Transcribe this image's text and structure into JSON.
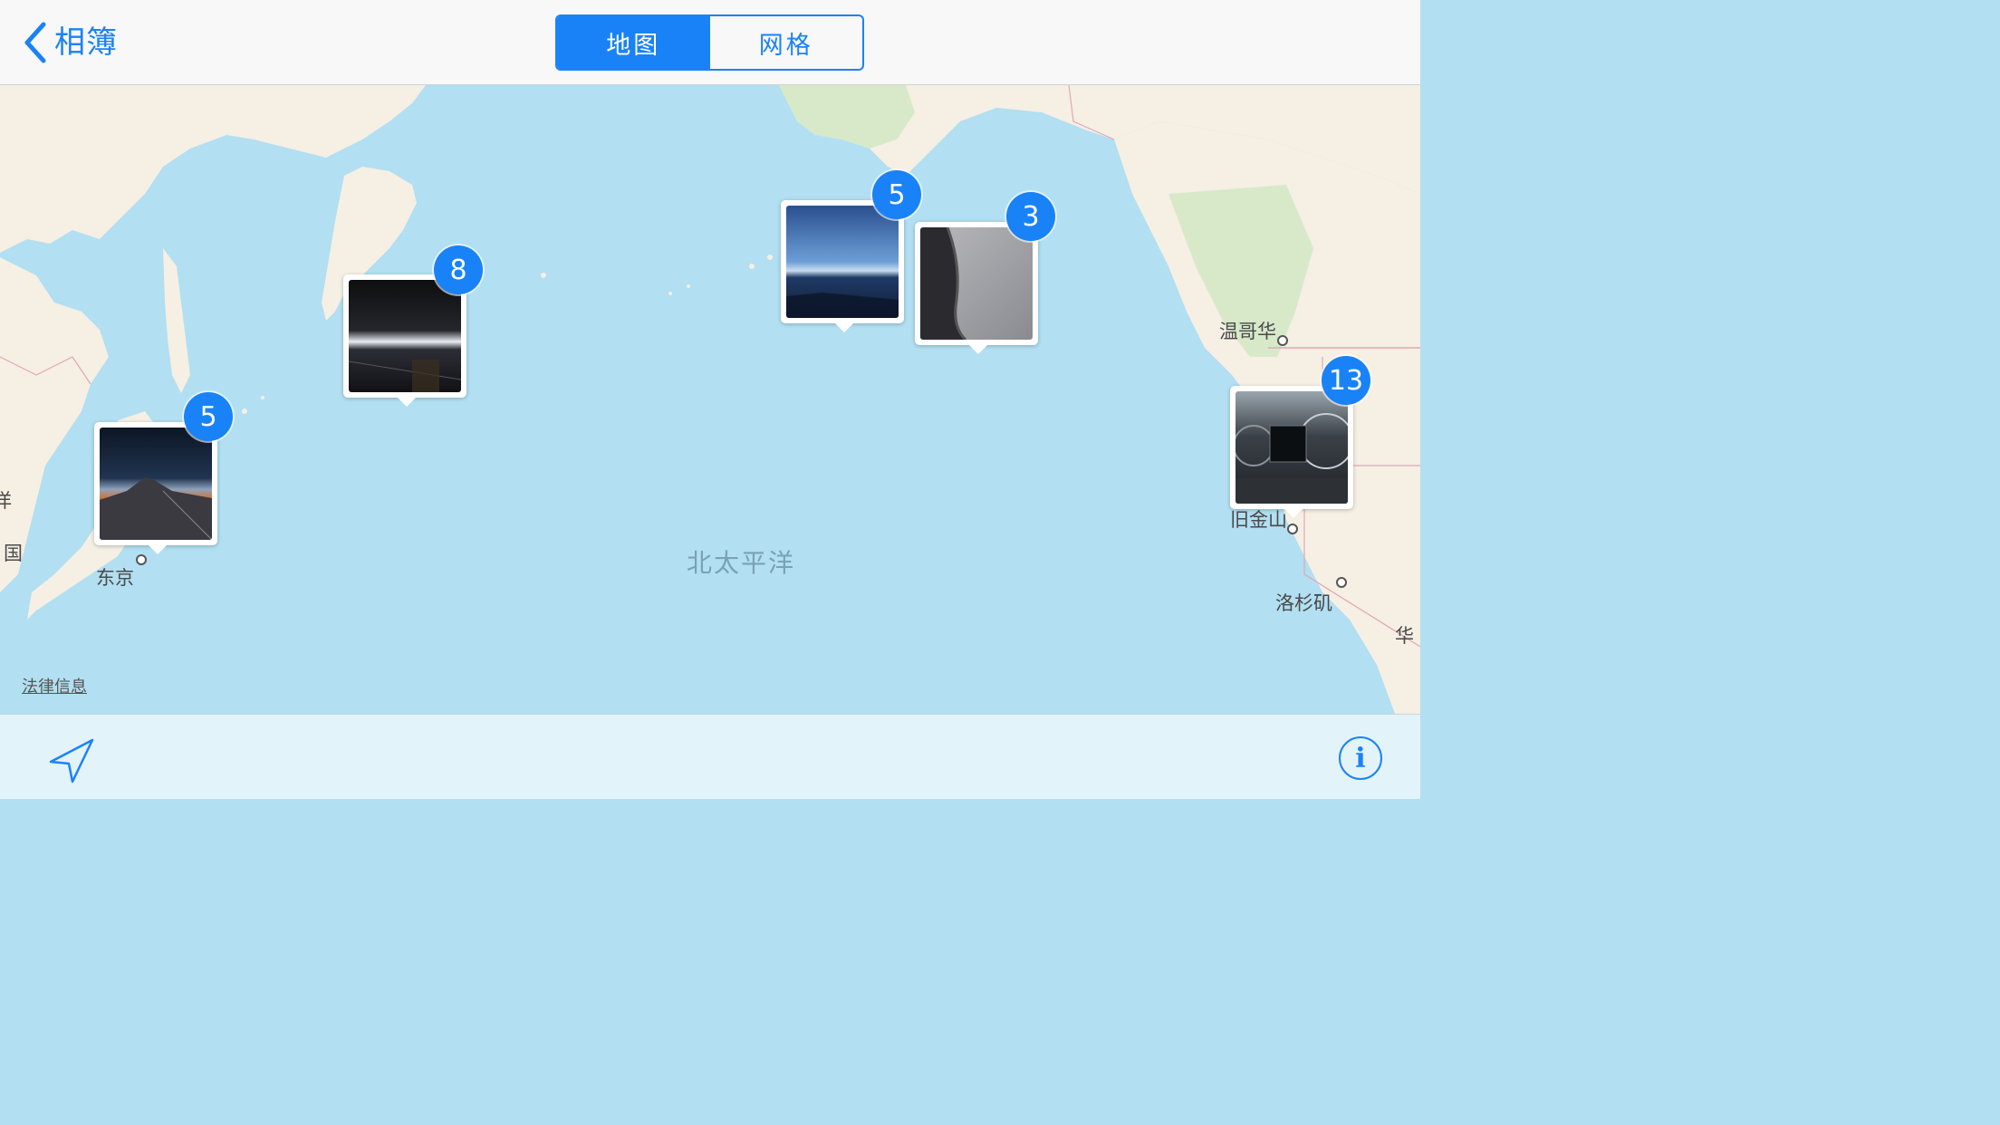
{
  "nav": {
    "back_label": "相簿",
    "segments": [
      {
        "label": "地图",
        "active": true
      },
      {
        "label": "网格",
        "active": false
      }
    ]
  },
  "map": {
    "ocean_label": "北太平洋",
    "legal_label": "法律信息",
    "places": {
      "tokyo": "东京",
      "vancouver": "温哥华",
      "san_francisco": "旧金山",
      "los_angeles": "洛杉矶",
      "edge_left_1": "洋",
      "edge_left_2": "国",
      "edge_right": "华"
    },
    "pins": [
      {
        "id": "tokyo",
        "count": "5",
        "photo": "sunset-mountain"
      },
      {
        "id": "kamchatka",
        "count": "8",
        "photo": "night-horizon"
      },
      {
        "id": "alaska-a",
        "count": "5",
        "photo": "blue-horizon"
      },
      {
        "id": "alaska-b",
        "count": "3",
        "photo": "clouds-wing"
      },
      {
        "id": "sf",
        "count": "13",
        "photo": "dashboard"
      }
    ]
  },
  "toolbar": {
    "location_icon": "location-arrow-icon",
    "info_icon": "info-icon",
    "info_glyph": "i"
  },
  "colors": {
    "accent": "#1a82f7",
    "water": "#b2dff2",
    "land": "#f5efe4",
    "forest": "#d7e9c9"
  }
}
